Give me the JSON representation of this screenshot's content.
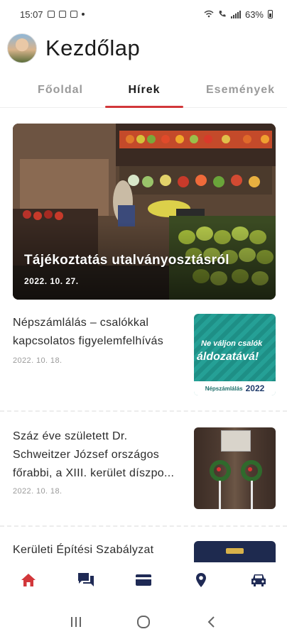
{
  "status_bar": {
    "time": "15:07",
    "battery": "63%"
  },
  "header": {
    "title": "Kezdőlap"
  },
  "tabs": [
    {
      "label": "Főoldal"
    },
    {
      "label": "Hírek"
    },
    {
      "label": "Események"
    }
  ],
  "hero": {
    "title": "Tájékoztatás utalványosztásról",
    "date": "2022. 10. 27."
  },
  "news": [
    {
      "title": "Népszámlálás – csalókkal kapcsolatos figyelemfelhívás",
      "date": "2022. 10. 18.",
      "thumb_line1": "Ne váljon csalók",
      "thumb_line2": "áldozatává!",
      "thumb_footer": "Népszámlálás",
      "thumb_year": "2022"
    },
    {
      "title": "Száz éve született Dr. Schweitzer József országos főrabbi, a XIII. kerület díszpo...",
      "date": "2022. 10. 18."
    },
    {
      "title": "Kerületi Építési Szabályzat",
      "date": ""
    }
  ],
  "bottom_nav": {
    "items": [
      {
        "icon": "home-icon",
        "active": true
      },
      {
        "icon": "chat-icon",
        "active": false
      },
      {
        "icon": "card-icon",
        "active": false
      },
      {
        "icon": "location-pin-icon",
        "active": false
      },
      {
        "icon": "car-icon",
        "active": false
      }
    ]
  },
  "colors": {
    "accent": "#d2373a",
    "nav_icon": "#1f2a55",
    "muted": "#9a9a9a"
  }
}
